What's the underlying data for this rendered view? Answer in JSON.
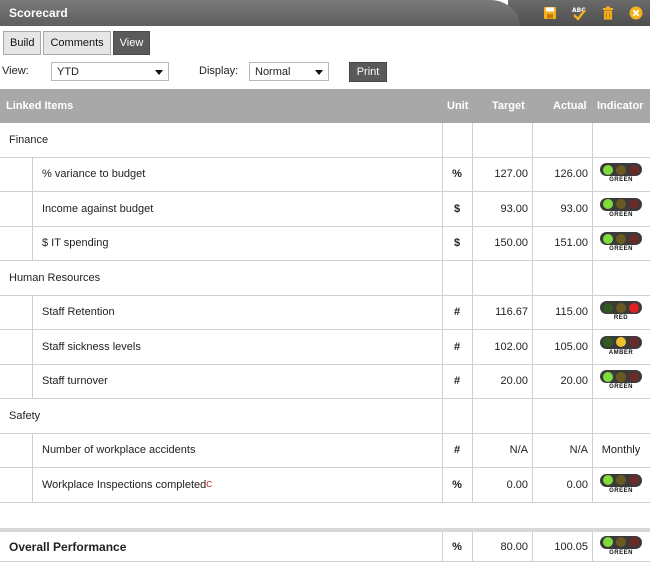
{
  "window": {
    "title": "Scorecard"
  },
  "toolbar": {
    "icons": [
      "save-icon",
      "spellcheck-icon",
      "trash-icon",
      "close-icon"
    ]
  },
  "tabs": [
    {
      "label": "Build",
      "active": false
    },
    {
      "label": "Comments",
      "active": false
    },
    {
      "label": "View",
      "active": true
    }
  ],
  "controls": {
    "view_label": "View:",
    "view_value": "YTD",
    "display_label": "Display:",
    "display_value": "Normal",
    "print_label": "Print"
  },
  "table": {
    "headers": {
      "item": "Linked Items",
      "unit": "Unit",
      "target": "Target",
      "actual": "Actual",
      "indicator": "Indicator"
    },
    "groups": [
      {
        "name": "Finance",
        "items": [
          {
            "name": "% variance to budget",
            "unit": "%",
            "target": "127.00",
            "actual": "126.00",
            "status": "GREEN"
          },
          {
            "name": "Income against budget",
            "unit": "$",
            "target": "93.00",
            "actual": "93.00",
            "status": "GREEN"
          },
          {
            "name": "$ IT spending",
            "unit": "$",
            "target": "150.00",
            "actual": "151.00",
            "status": "GREEN"
          }
        ]
      },
      {
        "name": "Human Resources",
        "items": [
          {
            "name": "Staff Retention",
            "unit": "#",
            "target": "116.67",
            "actual": "115.00",
            "status": "RED"
          },
          {
            "name": "Staff sickness levels",
            "unit": "#",
            "target": "102.00",
            "actual": "105.00",
            "status": "AMBER"
          },
          {
            "name": "Staff turnover",
            "unit": "#",
            "target": "20.00",
            "actual": "20.00",
            "status": "GREEN"
          }
        ]
      },
      {
        "name": "Safety",
        "items": [
          {
            "name": "Number of workplace accidents",
            "unit": "#",
            "target": "N/A",
            "actual": "N/A",
            "indicator_text": "Monthly"
          },
          {
            "name": "Workplace Inspections completed",
            "superscript": "C",
            "unit": "%",
            "target": "0.00",
            "actual": "0.00",
            "status": "GREEN"
          }
        ]
      }
    ]
  },
  "overall": {
    "label": "Overall Performance",
    "unit": "%",
    "target": "80.00",
    "actual": "100.05",
    "status": "GREEN"
  },
  "colors": {
    "green": "#7fdc3c",
    "amber": "#f0c030",
    "red": "#e02020",
    "off": "#6b2a2a"
  }
}
